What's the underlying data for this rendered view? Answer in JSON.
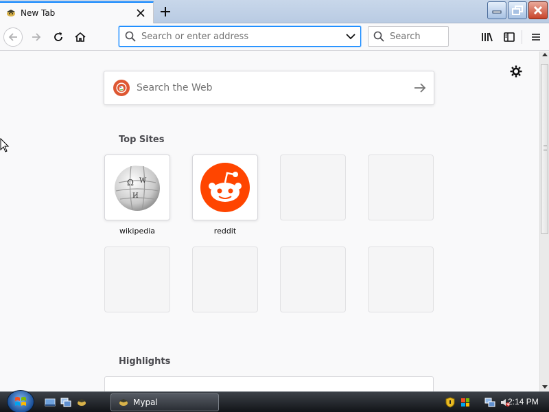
{
  "tab": {
    "title": "New Tab",
    "favicon": "mypal-icon"
  },
  "toolbar": {
    "url_placeholder": "Search or enter address",
    "search_placeholder": "Search"
  },
  "newtab": {
    "websearch_placeholder": "Search the Web",
    "top_sites_title": "Top Sites",
    "highlights_title": "Highlights",
    "top_sites": [
      {
        "label": "wikipedia",
        "icon": "wikipedia-globe-icon"
      },
      {
        "label": "reddit",
        "icon": "reddit-icon"
      }
    ]
  },
  "taskbar": {
    "app_label": "Mypal",
    "clock": "2:14 PM"
  },
  "colors": {
    "accent": "#0a84ff",
    "reddit": "#ff4500",
    "duckduckgo": "#de5833"
  }
}
